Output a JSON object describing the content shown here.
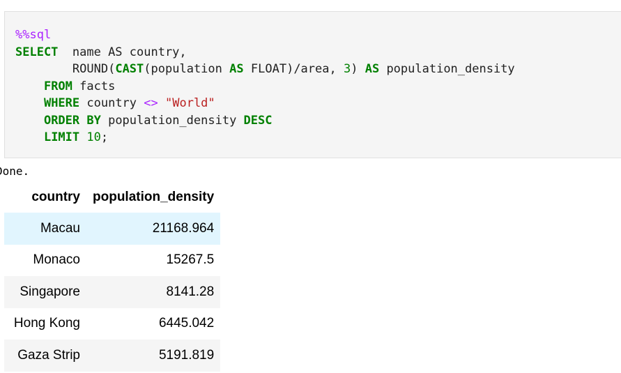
{
  "cell": {
    "magic": "%%sql",
    "lines": {
      "l1_kw": "SELECT",
      "l1_rest": "  name AS country,",
      "l2_fn": "ROUND",
      "l2_cast": "CAST",
      "l2_col": "population",
      "l2_as": "AS",
      "l2_type": "FLOAT",
      "l2_div": "/area, ",
      "l2_num": "3",
      "l2_as2": "AS",
      "l2_alias": "population_density",
      "l3_kw": "FROM",
      "l3_rest": " facts",
      "l4_kw": "WHERE",
      "l4_col": " country ",
      "l4_op": "<>",
      "l4_str": "\"World\"",
      "l5_kw": "ORDER BY",
      "l5_col": " population_density ",
      "l5_kw2": "DESC",
      "l6_kw": "LIMIT",
      "l6_num": "10",
      "l6_end": ";"
    }
  },
  "output": {
    "status": "Done.",
    "table": {
      "headers": [
        "country",
        "population_density"
      ],
      "rows": [
        {
          "country": "Macau",
          "population_density": "21168.964"
        },
        {
          "country": "Monaco",
          "population_density": "15267.5"
        },
        {
          "country": "Singapore",
          "population_density": "8141.28"
        },
        {
          "country": "Hong Kong",
          "population_density": "6445.042"
        },
        {
          "country": "Gaza Strip",
          "population_density": "5191.819"
        }
      ]
    }
  },
  "colors": {
    "keyword": "#008000",
    "magic": "#aa22ff",
    "string": "#ba2121",
    "cell_bg": "#f5f5f5",
    "row_hover": "#e1f5fe"
  }
}
